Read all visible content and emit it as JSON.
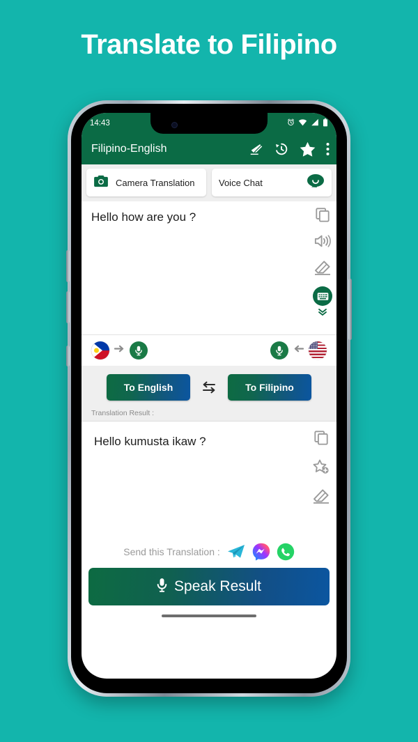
{
  "promo": {
    "title": "Translate to Filipino",
    "background_color": "#13b5ac",
    "title_color": "#ffffff"
  },
  "phone": {
    "status_bar": {
      "time": "14:43",
      "icons": [
        "alarm-icon",
        "wifi-icon",
        "signal-icon",
        "battery-icon"
      ],
      "background_color": "#0b6b45"
    },
    "app_bar": {
      "title": "Filipino-English",
      "background_color": "#0b6b45",
      "actions": [
        {
          "name": "eraser-icon",
          "label": "Clear"
        },
        {
          "name": "history-icon",
          "label": "History"
        },
        {
          "name": "star-icon",
          "label": "Favorites"
        },
        {
          "name": "overflow-menu-icon",
          "label": "More options"
        }
      ]
    },
    "quick_actions": [
      {
        "label": "Camera Translation",
        "icon": "camera-icon"
      },
      {
        "label": "Voice Chat",
        "icon": "chat-bubble-icon"
      }
    ],
    "source_panel": {
      "text": "Hello how are you ?",
      "icons": [
        "copy-icon",
        "speaker-icon",
        "eraser-icon",
        "keyboard-icon",
        "chevron-down-icon"
      ]
    },
    "language_row": {
      "left": {
        "flag": "philippines-flag-icon",
        "mic": "microphone-icon",
        "arrow": "arrow-right-icon"
      },
      "right": {
        "flag": "usa-flag-icon",
        "mic": "microphone-icon",
        "arrow": "arrow-left-icon"
      }
    },
    "direction": {
      "to_english_label": "To English",
      "to_filipino_label": "To Filipino",
      "swap_icon": "swap-horizontal-icon",
      "button_gradient_start": "#0d6b42",
      "button_gradient_end": "#0b56a0"
    },
    "result_label": "Translation Result :",
    "result_panel": {
      "text": "Hello kumusta ikaw ?",
      "icons": [
        "copy-icon",
        "star-add-icon",
        "eraser-icon"
      ]
    },
    "send_row": {
      "label": "Send this Translation :",
      "apps": [
        {
          "name": "telegram-icon",
          "label": "Telegram"
        },
        {
          "name": "messenger-icon",
          "label": "Messenger"
        },
        {
          "name": "whatsapp-icon",
          "label": "WhatsApp"
        }
      ]
    },
    "speak_button": {
      "label": "Speak Result",
      "icon": "microphone-icon"
    }
  }
}
